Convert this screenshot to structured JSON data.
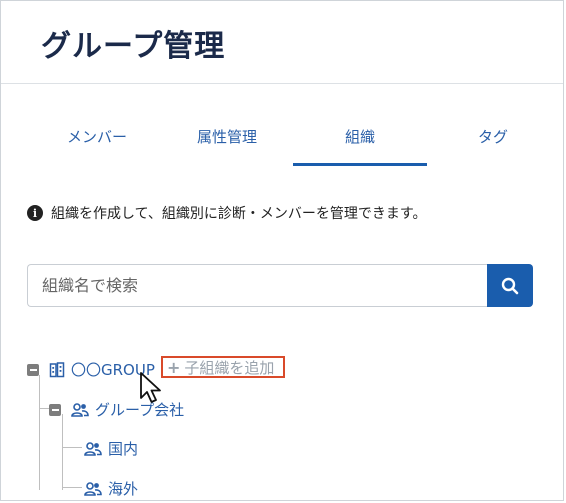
{
  "header": {
    "title": "グループ管理"
  },
  "tabs": [
    {
      "label": "メンバー",
      "active": false
    },
    {
      "label": "属性管理",
      "active": false
    },
    {
      "label": "組織",
      "active": true
    },
    {
      "label": "タグ",
      "active": false
    }
  ],
  "info": {
    "text": "組織を作成して、組織別に診断・メンバーを管理できます。"
  },
  "search": {
    "placeholder": "組織名で検索",
    "value": ""
  },
  "tree": {
    "root": {
      "label": "〇〇GROUP",
      "icon": "building-icon",
      "expanded": true
    },
    "add_child_label": "子組織を追加",
    "children": [
      {
        "label": "グループ会社",
        "icon": "users-icon",
        "expanded": true,
        "children": [
          {
            "label": "国内",
            "icon": "users-icon"
          },
          {
            "label": "海外",
            "icon": "users-icon"
          }
        ]
      }
    ]
  },
  "colors": {
    "accent": "#1a5dad",
    "title": "#1b2a4a",
    "highlight_border": "#d94a2a",
    "muted": "#9aa3ad"
  }
}
